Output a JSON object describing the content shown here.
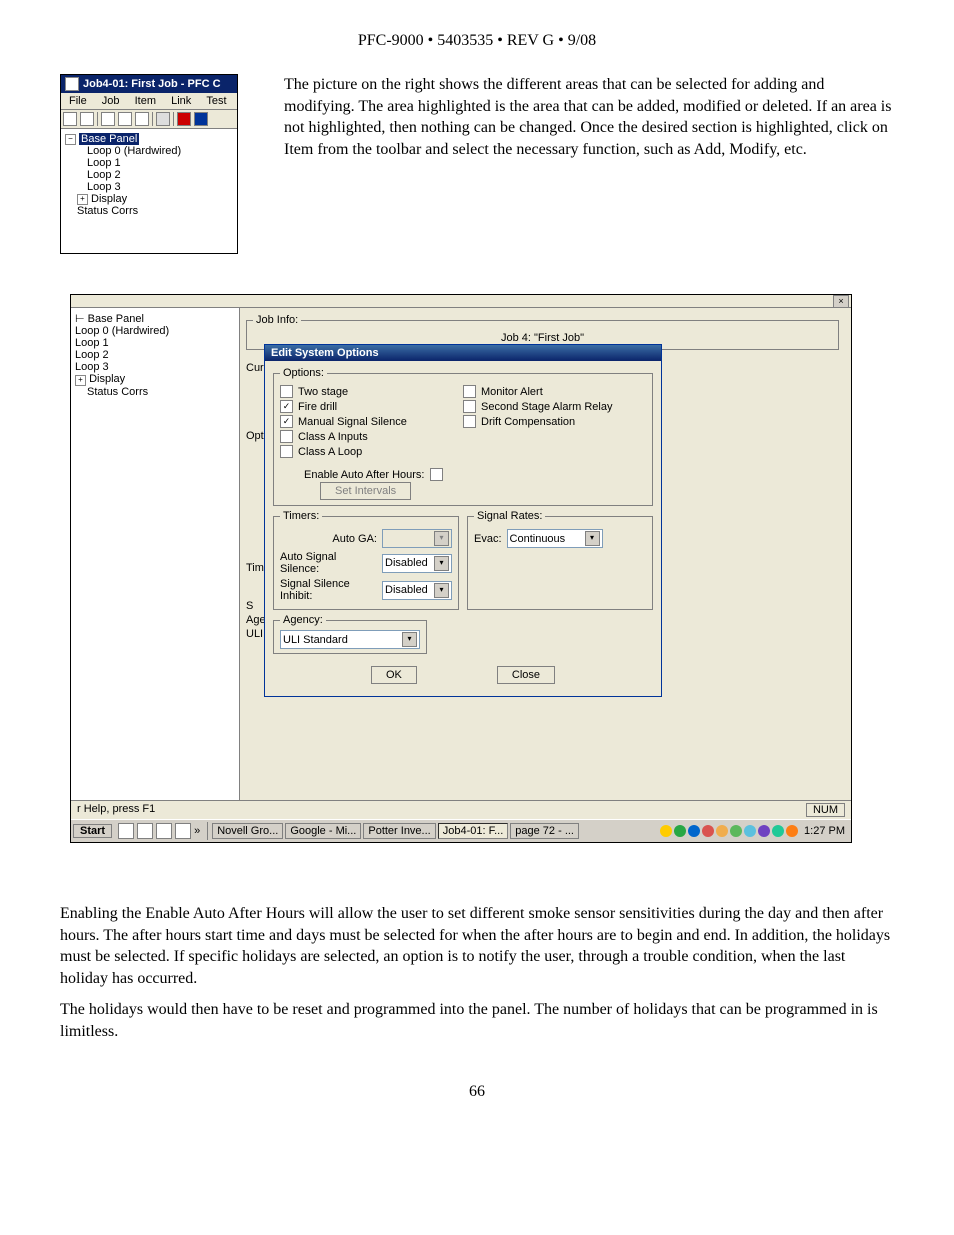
{
  "header": "PFC-9000 • 5403535 • REV G • 9/08",
  "intro_para": "The picture on the right shows the different areas that can be selected for adding and modifying. The area highlighted is the area that can be added, modified or deleted. If an area is not highlighted, then nothing can be changed. Once the desired section is highlighted, click on Item from the toolbar and select the necessary function, such as Add, Modify, etc.",
  "para2": "Enabling the Enable Auto After Hours will allow the user to set different smoke sensor sensitivities during the day and then after hours. The after hours start time and days must be selected for when the after hours are to begin and end. In addition, the holidays must be selected. If specific holidays are selected, an option is to notify the user, through a trouble condition, when the last holiday has occurred.",
  "para3": "The holidays would then have to be reset and programmed into the panel. The number of holidays that can be programmed in is limitless.",
  "page_number": "66",
  "smallwin": {
    "title": "Job4-01: First Job - PFC C",
    "menu": [
      "File",
      "Job",
      "Item",
      "Link",
      "Test"
    ],
    "tree": {
      "root": "Base Panel",
      "children": [
        "Loop 0  (Hardwired)",
        "Loop 1",
        "Loop 2",
        "Loop 3"
      ],
      "display": "Display",
      "status": "Status Corrs"
    }
  },
  "bigtree": {
    "root": "Base Panel",
    "children": [
      "Loop 0  (Hardwired)",
      "Loop 1",
      "Loop 2",
      "Loop 3"
    ],
    "display": "Display",
    "status": "Status Corrs"
  },
  "jobinfo": {
    "legend": "Job Info:",
    "title": "Job 4:  \"First Job\""
  },
  "partials": {
    "curr": "Curr",
    "opti": "Opti",
    "tim": "Tim",
    "s": "S",
    "age": "Age",
    "uli": "ULI"
  },
  "dialog": {
    "title": "Edit System Options",
    "options_legend": "Options:",
    "opts_left": [
      {
        "label": "Two stage",
        "checked": false
      },
      {
        "label": "Fire drill",
        "checked": true
      },
      {
        "label": "Manual Signal Silence",
        "checked": true
      },
      {
        "label": "Class A Inputs",
        "checked": false
      },
      {
        "label": "Class A Loop",
        "checked": false
      }
    ],
    "opts_right": [
      {
        "label": "Monitor Alert",
        "checked": false
      },
      {
        "label": "Second Stage Alarm Relay",
        "checked": false
      },
      {
        "label": "Drift Compensation",
        "checked": false
      }
    ],
    "after_hours_label": "Enable Auto After Hours:",
    "set_intervals": "Set Intervals",
    "timers_legend": "Timers:",
    "timers": {
      "auto_ga": {
        "label": "Auto GA:",
        "value": ""
      },
      "auto_sig_silence": {
        "label": "Auto Signal Silence:",
        "value": "Disabled"
      },
      "sig_silence_inhibit": {
        "label": "Signal Silence Inhibit:",
        "value": "Disabled"
      }
    },
    "rates_legend": "Signal Rates:",
    "evac": {
      "label": "Evac:",
      "value": "Continuous"
    },
    "agency_legend": "Agency:",
    "agency_value": "ULI Standard",
    "ok": "OK",
    "close": "Close"
  },
  "statusbar": {
    "help": "r Help, press F1",
    "num": "NUM"
  },
  "taskbar": {
    "start": "Start",
    "tasks": [
      {
        "label": "Novell Gro..."
      },
      {
        "label": "Google - Mi..."
      },
      {
        "label": "Potter Inve..."
      },
      {
        "label": "Job4-01: F...",
        "active": true
      },
      {
        "label": "page 72 - ..."
      }
    ],
    "time": "1:27 PM"
  }
}
